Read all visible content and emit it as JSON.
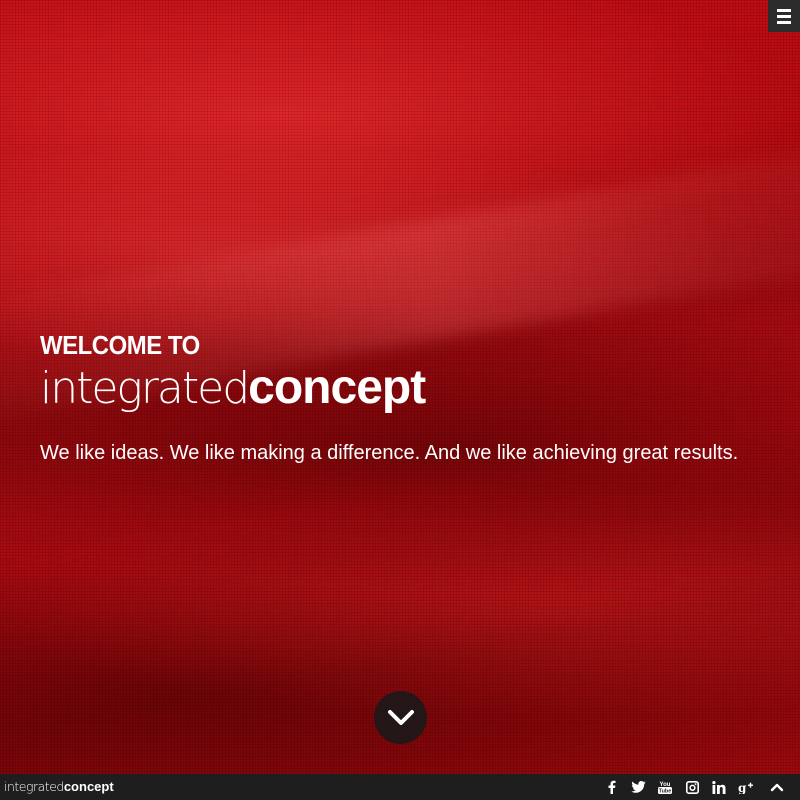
{
  "hero": {
    "welcome": "WELCOME TO",
    "brand_light": "integrated",
    "brand_bold": "concept",
    "tagline": "We like ideas. We like making a difference. And we like achieving great results."
  },
  "footer": {
    "brand_light": "integrated",
    "brand_bold": "concept",
    "social": [
      {
        "name": "facebook-icon",
        "glyph": "f"
      },
      {
        "name": "twitter-icon",
        "glyph": "t"
      },
      {
        "name": "youtube-icon",
        "glyph": "You"
      },
      {
        "name": "instagram-icon",
        "glyph": ""
      },
      {
        "name": "linkedin-icon",
        "glyph": "in"
      },
      {
        "name": "google-plus-icon",
        "glyph": "g+"
      }
    ]
  },
  "icons": {
    "menu": "hamburger-menu-icon",
    "scroll_down": "chevron-down-icon",
    "back_to_top": "chevron-up-icon"
  },
  "colors": {
    "accent": "#c70f16",
    "footer_bg": "#1e1e1e",
    "menu_bg": "#2c2c2c"
  }
}
